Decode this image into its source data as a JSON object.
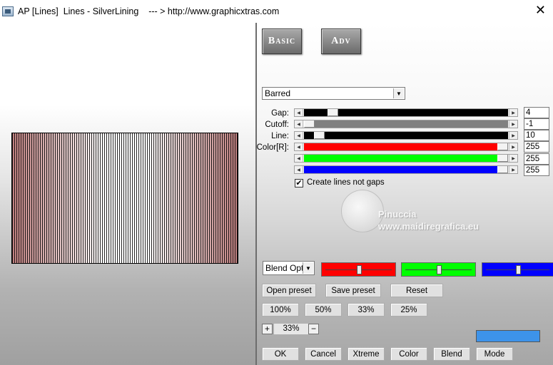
{
  "window": {
    "title": "AP [Lines]  Lines - SilverLining    --- > http://www.graphicxtras.com",
    "close_glyph": "✕"
  },
  "tabs": {
    "basic": "Basic",
    "adv": "Adv"
  },
  "style_dropdown": {
    "value": "Barred"
  },
  "sliders": {
    "gap": {
      "label": "Gap:",
      "value": "4",
      "fraction": 0.12,
      "color": "#000000"
    },
    "cutoff": {
      "label": "Cutoff:",
      "value": "-1",
      "fraction": 0.0,
      "color": "#808080"
    },
    "line": {
      "label": "Line:",
      "value": "10",
      "fraction": 0.05,
      "color": "#000000"
    },
    "color_r": {
      "label": "Color[R]:",
      "value": "255",
      "fraction": 1.0,
      "color": "#ff0000"
    },
    "color_g": {
      "label": "",
      "value": "255",
      "fraction": 1.0,
      "color": "#00ff00"
    },
    "color_b": {
      "label": "",
      "value": "255",
      "fraction": 1.0,
      "color": "#0000ff"
    }
  },
  "checkbox": {
    "label": "Create lines not gaps",
    "checked": true,
    "mark": "✔"
  },
  "watermark": {
    "line1": "Pinuccia",
    "line2": "www.maidiregrafica.eu"
  },
  "blend_dropdown": {
    "value": "Blend Optio"
  },
  "color_swatches": [
    {
      "name": "red",
      "color": "#ff0000",
      "level": 0.5
    },
    {
      "name": "green",
      "color": "#00ff00",
      "level": 0.5
    },
    {
      "name": "blue",
      "color": "#0000ff",
      "level": 0.5
    }
  ],
  "preset_buttons": {
    "open": "Open preset",
    "save": "Save preset",
    "reset": "Reset"
  },
  "zoom_buttons": {
    "z100": "100%",
    "z50": "50%",
    "z33": "33%",
    "z25": "25%"
  },
  "zoom": {
    "plus": "+",
    "minus": "−",
    "value": "33%"
  },
  "bottom_buttons": {
    "ok": "OK",
    "cancel": "Cancel",
    "xtreme": "Xtreme",
    "color": "Color",
    "blend": "Blend",
    "mode": "Mode"
  },
  "accent_color": "#3d93ea"
}
